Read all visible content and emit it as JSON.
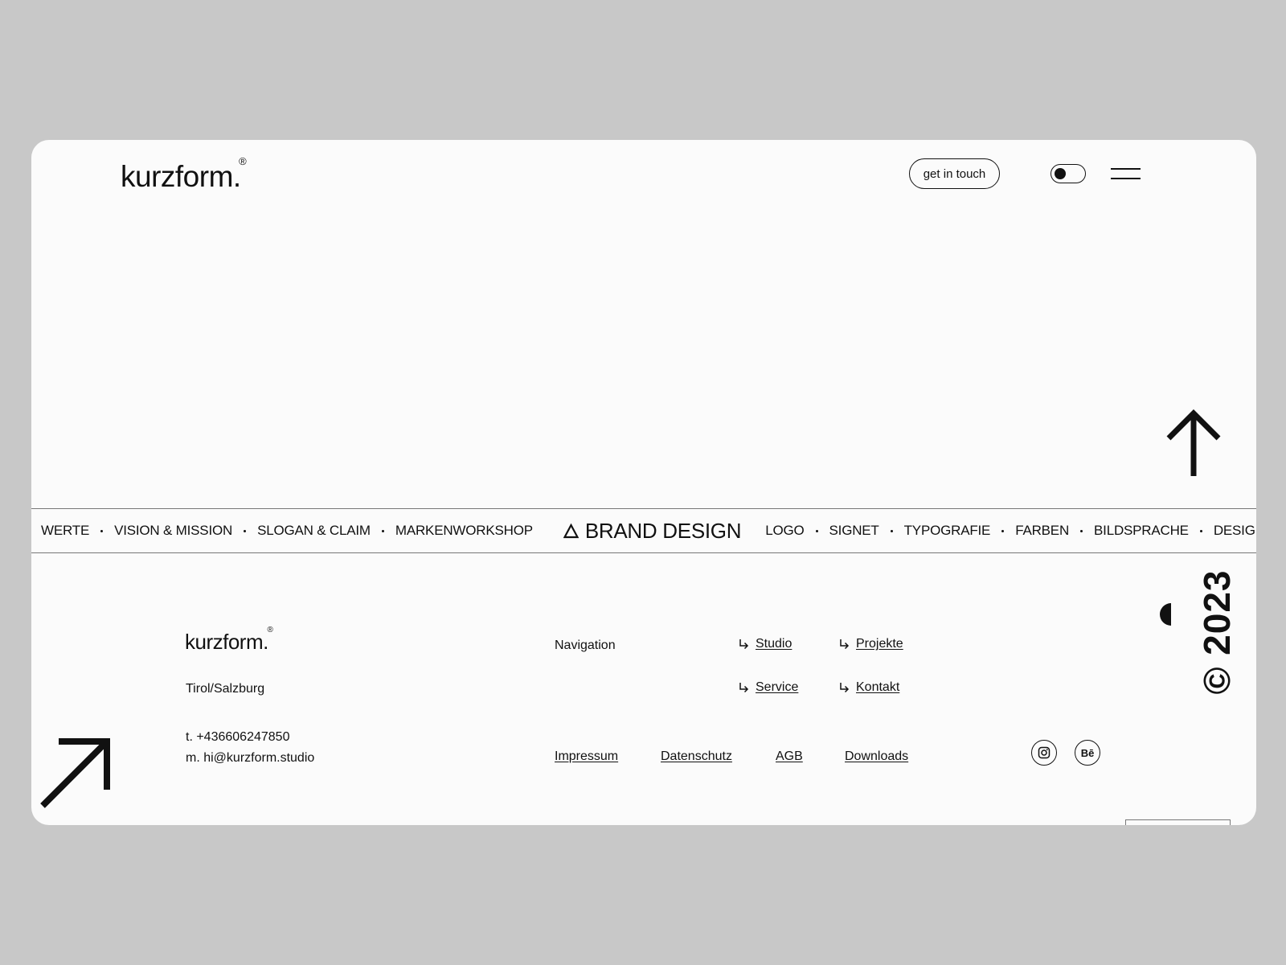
{
  "brand": {
    "name": "kurzform.",
    "registered": "®"
  },
  "header": {
    "cta_label": "get in touch",
    "theme_toggle": "dark-mode-toggle",
    "menu_icon": "hamburger-menu-icon"
  },
  "scroll_top_icon": "arrow-up-icon",
  "marquee": {
    "left_items": [
      "WERTE",
      "VISION & MISSION",
      "SLOGAN & CLAIM",
      "MARKENWORKSHOP"
    ],
    "center_icon": "delta-triangle-icon",
    "center_label": "BRAND DESIGN",
    "right_items": [
      "LOGO",
      "SIGNET",
      "TYPOGRAFIE",
      "FARBEN",
      "BILDSPRACHE",
      "DESIGNEL"
    ]
  },
  "footer": {
    "region": "Tirol/Salzburg",
    "phone": "t. +436606247850",
    "email": "m. hi@kurzform.studio",
    "nav_label": "Navigation",
    "nav_links": [
      "Studio",
      "Projekte",
      "Service",
      "Kontakt"
    ],
    "legal_links": [
      "Impressum",
      "Datenschutz",
      "AGB",
      "Downloads"
    ],
    "social": {
      "instagram_icon": "instagram-icon",
      "behance_label": "Bē"
    },
    "copyright": "© 2023",
    "corner_icon": "arrow-up-right-icon"
  },
  "colors": {
    "page_bg": "#c8c8c8",
    "card_bg": "#fbfbfb",
    "ink": "#111111",
    "divider": "#777777"
  }
}
